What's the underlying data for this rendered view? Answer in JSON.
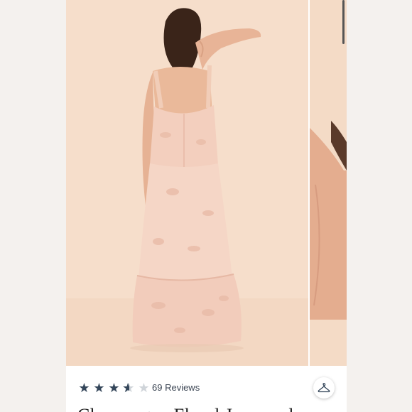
{
  "gallery": {
    "main_image": "dress-back-view-photo",
    "next_image": "dress-side-view-photo-partial"
  },
  "product": {
    "rating": 3.5,
    "rating_max": 5,
    "reviews_label": "69 Reviews",
    "title_partial": "Champagne Floral Jacquard"
  },
  "icons": {
    "wishlist": "hanger-icon"
  },
  "colors": {
    "star_filled": "#34465a",
    "star_empty": "#cfd4d9",
    "backdrop": "#f6decb"
  }
}
